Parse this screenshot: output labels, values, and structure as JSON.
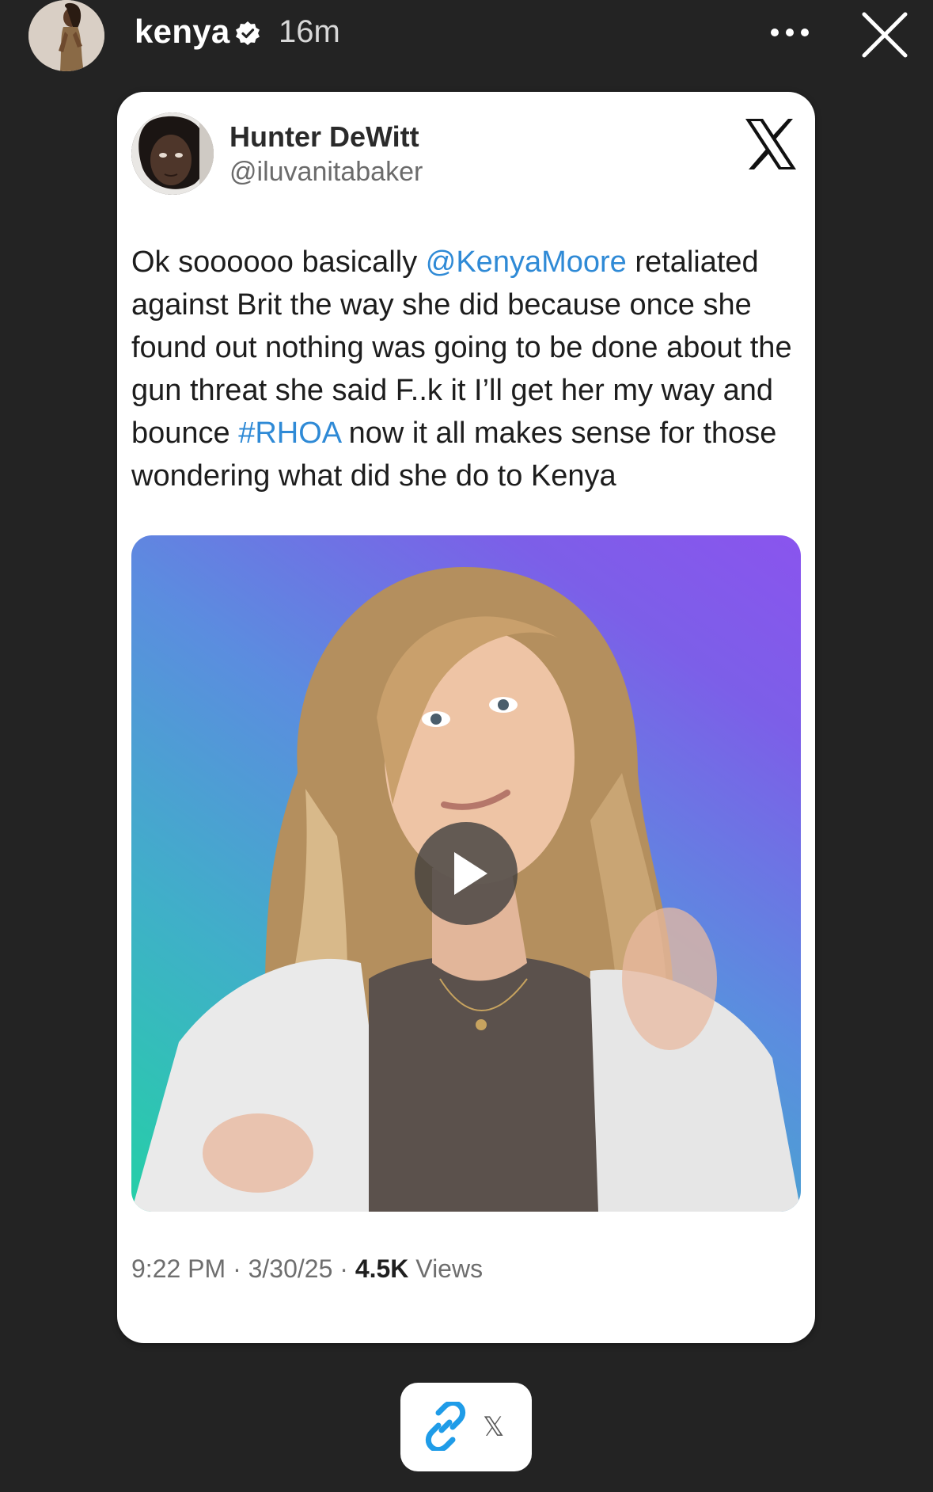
{
  "story": {
    "username": "kenya",
    "time_ago": "16m",
    "verified": true
  },
  "tweet": {
    "author_name": "Hunter DeWitt",
    "author_handle": "@iluvanitabaker",
    "text_segments": [
      {
        "text": "Ok soooooo basically ",
        "link": false
      },
      {
        "text": "@KenyaMoore",
        "link": true
      },
      {
        "text": " retaliated against Brit the way she did because once she found out nothing was going to be done about the gun threat she said F..k it I’ll get her my way and bounce ",
        "link": false
      },
      {
        "text": "#RHOA",
        "link": true
      },
      {
        "text": " now it all makes sense for those wondering what did she do to Kenya",
        "link": false
      }
    ],
    "timestamp": "9:22 PM · 3/30/25 · ",
    "views_count": "4.5K",
    "views_label": " Views"
  },
  "link_sticker": {
    "label": "𝕏"
  },
  "colors": {
    "background": "#232323",
    "link": "#2f8ad6",
    "sticker_icon": "#1f9ce8"
  },
  "icons": [
    "verified-icon",
    "more-icon",
    "close-icon",
    "x-logo-icon",
    "play-icon",
    "link-icon"
  ]
}
